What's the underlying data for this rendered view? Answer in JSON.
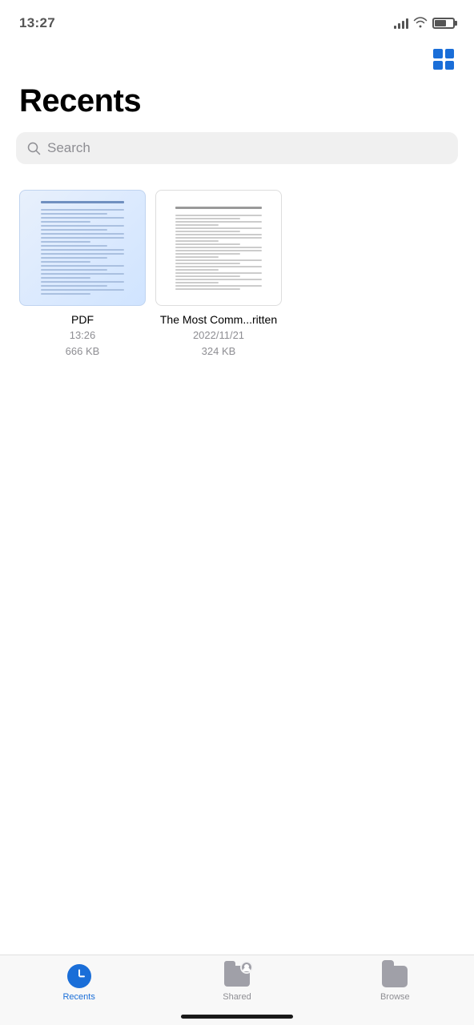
{
  "statusBar": {
    "time": "13:27"
  },
  "header": {
    "gridButtonLabel": "Toggle grid view"
  },
  "page": {
    "title": "Recents"
  },
  "search": {
    "placeholder": "Search"
  },
  "files": [
    {
      "id": "file-1",
      "name": "PDF",
      "date": "13:26",
      "size": "666 KB",
      "type": "pdf"
    },
    {
      "id": "file-2",
      "name": "The Most Comm...ritten",
      "date": "2022/11/21",
      "size": "324 KB",
      "type": "doc"
    }
  ],
  "tabBar": {
    "items": [
      {
        "id": "recents",
        "label": "Recents",
        "active": true
      },
      {
        "id": "shared",
        "label": "Shared",
        "active": false
      },
      {
        "id": "browse",
        "label": "Browse",
        "active": false
      }
    ]
  }
}
